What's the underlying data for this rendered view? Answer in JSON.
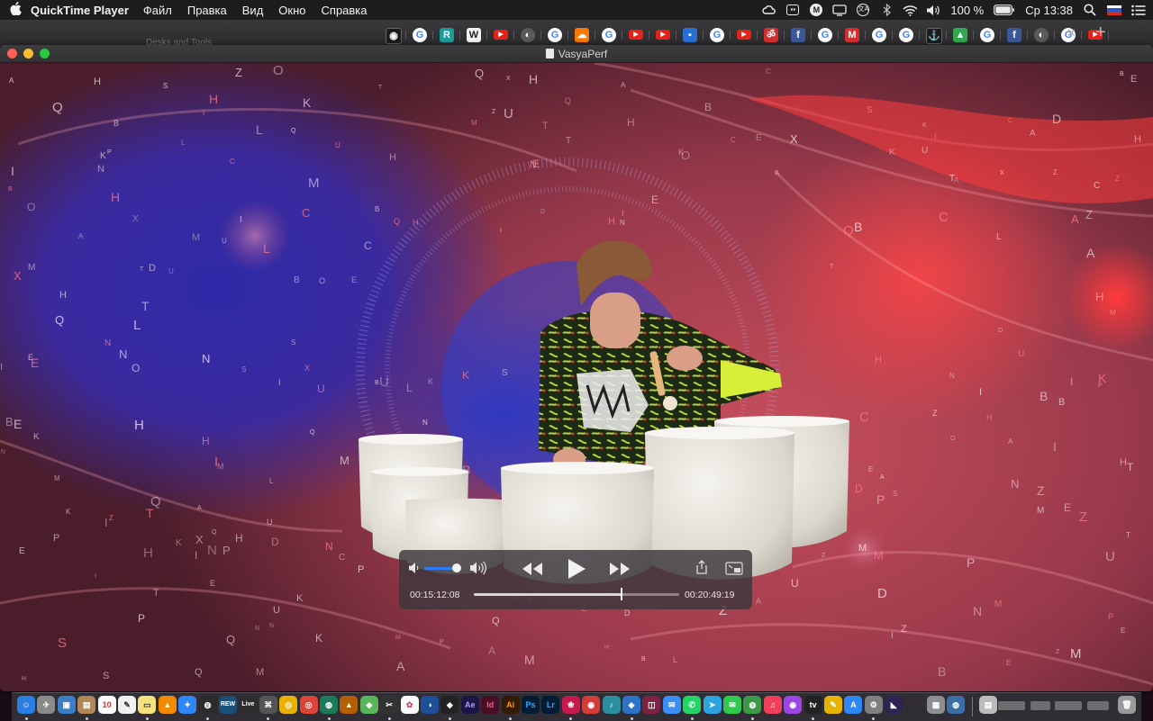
{
  "menubar": {
    "app_name": "QuickTime Player",
    "items": [
      "Файл",
      "Правка",
      "Вид",
      "Окно",
      "Справка"
    ],
    "battery": "100 %",
    "clock": "Ср 13:38",
    "status_icons": [
      "creative-cloud-icon",
      "screen-icon",
      "m-icon",
      "display-icon",
      "translate-icon",
      "bluetooth-icon",
      "wifi-icon",
      "volume-icon",
      "battery-icon",
      "search-icon",
      "russian-flag-icon",
      "list-icon"
    ]
  },
  "browser_strip": {
    "ghost_title": "Desks and Tools",
    "favicons": [
      {
        "kind": "dark",
        "glyph": "◉"
      },
      {
        "kind": "g",
        "glyph": "G"
      },
      {
        "kind": "teal",
        "glyph": "R"
      },
      {
        "kind": "white",
        "glyph": "W"
      },
      {
        "kind": "yt",
        "glyph": "▶"
      },
      {
        "kind": "gray",
        "glyph": "◐"
      },
      {
        "kind": "g",
        "glyph": "G"
      },
      {
        "kind": "orange",
        "glyph": "☁"
      },
      {
        "kind": "g",
        "glyph": "G"
      },
      {
        "kind": "yt",
        "glyph": "▶"
      },
      {
        "kind": "yt",
        "glyph": "▶"
      },
      {
        "kind": "blue",
        "glyph": "▪"
      },
      {
        "kind": "g",
        "glyph": "G"
      },
      {
        "kind": "yt",
        "glyph": "▶"
      },
      {
        "kind": "red",
        "glyph": "ॐ"
      },
      {
        "kind": "fb",
        "glyph": "f"
      },
      {
        "kind": "g",
        "glyph": "G"
      },
      {
        "kind": "red",
        "glyph": "M"
      },
      {
        "kind": "g",
        "glyph": "G"
      },
      {
        "kind": "g",
        "glyph": "G"
      },
      {
        "kind": "dark",
        "glyph": "⚓"
      },
      {
        "kind": "green",
        "glyph": "▲"
      },
      {
        "kind": "g",
        "glyph": "G"
      },
      {
        "kind": "fb",
        "glyph": "f"
      },
      {
        "kind": "gray",
        "glyph": "◐"
      },
      {
        "kind": "g",
        "glyph": "G"
      },
      {
        "kind": "yt",
        "glyph": "▶"
      }
    ],
    "close_glyph": "✕",
    "new_tab_glyph": "+"
  },
  "window": {
    "title": "VasyaPerf",
    "traffic_lights": {
      "close": "#ff5f57",
      "minimize": "#febc2e",
      "zoom": "#28c840"
    }
  },
  "player": {
    "time_elapsed": "00:15:12:08",
    "time_remaining": "00:20:49:19",
    "progress": 0.72,
    "volume": 0.9,
    "buttons": {
      "rewind": "rewind-icon",
      "play": "play-icon",
      "fast_forward": "fast-forward-icon",
      "share": "share-icon",
      "pip": "picture-in-picture-icon",
      "volume_low": "volume-low-icon",
      "volume_high": "volume-high-icon"
    }
  },
  "video_letters": "AEHLOCQUSNTIPMDZXKB",
  "dock": {
    "apps": [
      {
        "name": "finder",
        "color": "#2a7de1",
        "glyph": "☺"
      },
      {
        "name": "launchpad",
        "color": "#8a8a8a",
        "glyph": "✈"
      },
      {
        "name": "preview",
        "color": "#3d7ec9",
        "glyph": "▣"
      },
      {
        "name": "notes-folder",
        "color": "#b08858",
        "glyph": "▤"
      },
      {
        "name": "calendar",
        "color": "#ffffff",
        "glyph": "10",
        "text": "#d33"
      },
      {
        "name": "textedit",
        "color": "#f0f0f0",
        "glyph": "✎",
        "text": "#333"
      },
      {
        "name": "stickies",
        "color": "#f5e27a",
        "glyph": "▭",
        "text": "#333"
      },
      {
        "name": "vlc",
        "color": "#f28a00",
        "glyph": "▲"
      },
      {
        "name": "safari",
        "color": "#2f86f6",
        "glyph": "✦"
      },
      {
        "name": "activity",
        "color": "#2b2b2b",
        "glyph": "◍"
      },
      {
        "name": "rewire",
        "color": "#1a4f7a",
        "glyph": "REW"
      },
      {
        "name": "ableton-live",
        "color": "#2d2d2d",
        "glyph": "Live"
      },
      {
        "name": "script-editor",
        "color": "#555",
        "glyph": "⌘"
      },
      {
        "name": "chrome-canary",
        "color": "#e8b100",
        "glyph": "◎"
      },
      {
        "name": "chrome",
        "color": "#db4437",
        "glyph": "◎"
      },
      {
        "name": "world-clock",
        "color": "#1c7a5a",
        "glyph": "◍"
      },
      {
        "name": "cyberduck",
        "color": "#b45f00",
        "glyph": "▲"
      },
      {
        "name": "maps",
        "color": "#5ab55a",
        "glyph": "◆"
      },
      {
        "name": "final-cut",
        "color": "#333",
        "glyph": "✂"
      },
      {
        "name": "photos",
        "color": "#fafafa",
        "glyph": "✿",
        "text": "#d0447a"
      },
      {
        "name": "cinema4d",
        "color": "#1f4f96",
        "glyph": "◑"
      },
      {
        "name": "unity",
        "color": "#222",
        "glyph": "◆"
      },
      {
        "name": "after-effects",
        "color": "#1d1545",
        "glyph": "Ae",
        "text": "#b39bff"
      },
      {
        "name": "indesign",
        "color": "#4a0e26",
        "glyph": "Id",
        "text": "#ff5a8a"
      },
      {
        "name": "illustrator",
        "color": "#331a00",
        "glyph": "Ai",
        "text": "#ff9a00"
      },
      {
        "name": "photoshop",
        "color": "#001d35",
        "glyph": "Ps",
        "text": "#31a8ff"
      },
      {
        "name": "lightroom",
        "color": "#001d35",
        "glyph": "Lr",
        "text": "#31a8ff"
      },
      {
        "name": "raspberry",
        "color": "#c51a4a",
        "glyph": "❀"
      },
      {
        "name": "app-red",
        "color": "#d43b3b",
        "glyph": "◉"
      },
      {
        "name": "app-teal",
        "color": "#2a8fa0",
        "glyph": "♪"
      },
      {
        "name": "app-blue",
        "color": "#2c72c7",
        "glyph": "◈"
      },
      {
        "name": "app-maroon",
        "color": "#7d2240",
        "glyph": "◫"
      },
      {
        "name": "messenger",
        "color": "#3a8ef5",
        "glyph": "✉"
      },
      {
        "name": "whatsapp",
        "color": "#25d366",
        "glyph": "✆"
      },
      {
        "name": "telegram",
        "color": "#2aa3df",
        "glyph": "➤"
      },
      {
        "name": "messages",
        "color": "#2fc94e",
        "glyph": "✉"
      },
      {
        "name": "app-green",
        "color": "#3d9a44",
        "glyph": "◍"
      },
      {
        "name": "music",
        "color": "#f03e5b",
        "glyph": "♫"
      },
      {
        "name": "podcasts",
        "color": "#9b45e3",
        "glyph": "◉"
      },
      {
        "name": "tv",
        "color": "#222",
        "glyph": "tv"
      },
      {
        "name": "app-yellow",
        "color": "#e6b400",
        "glyph": "✎"
      },
      {
        "name": "app-store",
        "color": "#2f86f6",
        "glyph": "A"
      },
      {
        "name": "system-prefs",
        "color": "#7f7f7f",
        "glyph": "⚙"
      },
      {
        "name": "logic",
        "color": "#2d2450",
        "glyph": "◣"
      },
      {
        "name": "app-gray",
        "color": "#8e8e93",
        "glyph": "▦"
      },
      {
        "name": "app-globe",
        "color": "#3a6ea5",
        "glyph": "◍"
      },
      {
        "name": "downloads",
        "color": "#bbbbbb",
        "glyph": "▤"
      },
      {
        "name": "trash",
        "color": "#9a9a9a",
        "glyph": "🗑"
      }
    ]
  }
}
